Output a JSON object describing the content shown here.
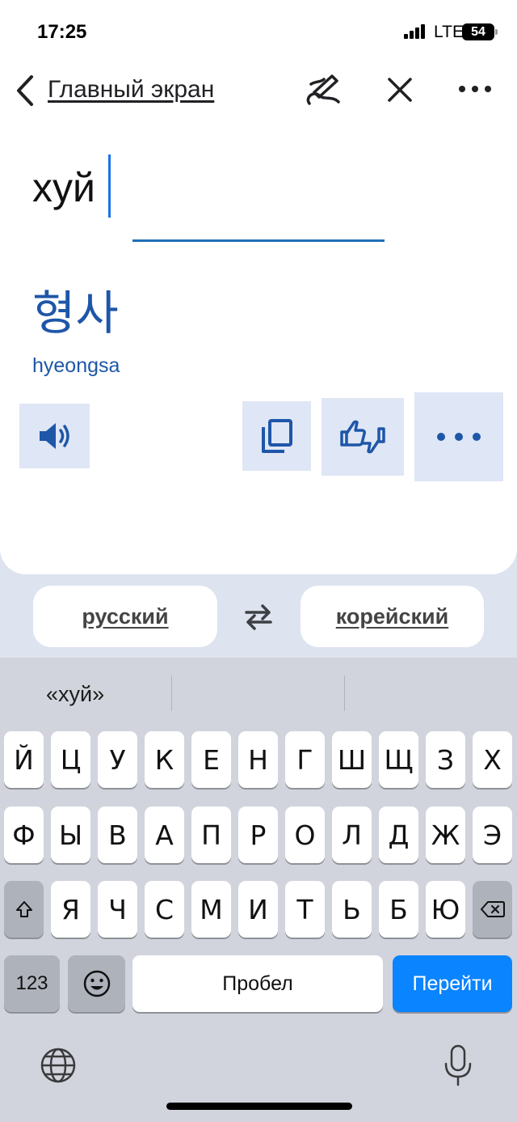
{
  "status_bar": {
    "time": "17:25",
    "network": "LTE",
    "battery": "54"
  },
  "header": {
    "back_label": "Главный экран"
  },
  "source": {
    "text": "хуй"
  },
  "translation": {
    "text": "형사",
    "transliteration": "hyeongsa"
  },
  "languages": {
    "source": "русский",
    "target": "корейский"
  },
  "keyboard": {
    "suggestion": "«хуй»",
    "row1": [
      "Й",
      "Ц",
      "У",
      "К",
      "Е",
      "Н",
      "Г",
      "Ш",
      "Щ",
      "З",
      "Х"
    ],
    "row2": [
      "Ф",
      "Ы",
      "В",
      "А",
      "П",
      "Р",
      "О",
      "Л",
      "Д",
      "Ж",
      "Э"
    ],
    "row3": [
      "Я",
      "Ч",
      "С",
      "М",
      "И",
      "Т",
      "Ь",
      "Б",
      "Ю"
    ],
    "numbers_label": "123",
    "space_label": "Пробел",
    "go_label": "Перейти"
  },
  "colors": {
    "accent": "#1e56a8",
    "go_key": "#0a84ff",
    "action_bg": "#dfe6f5"
  }
}
